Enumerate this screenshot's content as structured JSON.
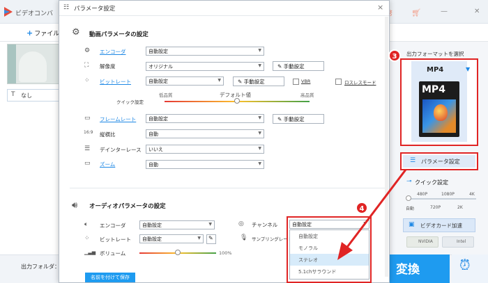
{
  "background_app": {
    "title": "ビデオコンバ",
    "add_file": "ファイル",
    "subtitle_value": "なし",
    "output_folder_label": "出力フォルダ："
  },
  "dialog": {
    "title": "パラメータ設定",
    "close": "×",
    "video_section_title": "動画パラメータの設定",
    "video_rows": {
      "encoder": {
        "label": "エンコーダ",
        "value": "自動設定"
      },
      "resolution": {
        "label": "解像度",
        "value": "オリジナル",
        "button": "手動設定"
      },
      "bitrate": {
        "label": "ビットレート",
        "value": "自動設定",
        "button": "手動設定",
        "vbr": "VBR",
        "lossless": "ロスレスモード"
      },
      "quick_setting": {
        "label": "クイック設定",
        "low": "低品質",
        "default": "デフォルト値",
        "high": "高品質"
      },
      "framerate": {
        "label": "フレームレート",
        "value": "自動設定",
        "button": "手動設定"
      },
      "aspect": {
        "label": "縦横比",
        "value": "自動"
      },
      "deinterlace": {
        "label": "デインターレース",
        "value": "いいえ"
      },
      "zoom": {
        "label": "ズーム",
        "value": "自動"
      }
    },
    "audio_section_title": "オーディオパラメータの設定",
    "audio_rows": {
      "encoder": {
        "label": "エンコーダ",
        "value": "自動設定"
      },
      "bitrate": {
        "label": "ビットレート",
        "value": "自動設定"
      },
      "volume": {
        "label": "ボリューム",
        "value_text": "100%"
      },
      "channel": {
        "label": "チャンネル",
        "value": "自動設定"
      },
      "sampling": {
        "label": "サンプリングレート"
      }
    },
    "save_named_button": "名前を付けて保存"
  },
  "channel_dropdown": {
    "options": [
      "自動設定",
      "モノラル",
      "ステレオ",
      "5.1chサラウンド"
    ],
    "highlighted_index": 2
  },
  "right_panel": {
    "output_format_label": "出力フォーマットを選択",
    "format_name": "MP4",
    "format_icon_text": "MP4",
    "param_button": "パラメータ設定",
    "quick_setting_label": "クイック設定",
    "quick_ticks_top": [
      "480P",
      "1080P",
      "4K"
    ],
    "quick_ticks_bottom": [
      "自動",
      "720P",
      "2K"
    ],
    "gpu_button": "ビデオカード加速",
    "nvidia": "NVIDIA",
    "intel": "Intel"
  },
  "convert_button": "変換",
  "step_markers": [
    "3",
    "4"
  ],
  "colors": {
    "accent": "#1e9bf0",
    "highlight_red": "#e02424",
    "dropdown_highlight": "#d7ebfa"
  }
}
